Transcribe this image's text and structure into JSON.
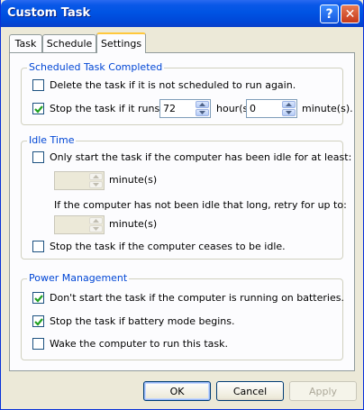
{
  "window": {
    "title": "Custom Task"
  },
  "title_buttons": {
    "help": "?",
    "close": "✕"
  },
  "tabs": [
    {
      "label": "Task"
    },
    {
      "label": "Schedule"
    },
    {
      "label": "Settings"
    }
  ],
  "scheduled": {
    "legend": "Scheduled Task Completed",
    "delete_label": "Delete the task if it is not scheduled to run again.",
    "delete_checked": false,
    "stop_label": "Stop the task if it runs for:",
    "stop_checked": true,
    "hours_value": "72",
    "hours_unit": "hour(s)",
    "minutes_value": "0",
    "minutes_unit": "minute(s)."
  },
  "idle": {
    "legend": "Idle Time",
    "only_start_label": "Only start the task if the computer has been idle for at least:",
    "only_start_checked": false,
    "idle_minutes_value": "",
    "idle_minutes_unit": "minute(s)",
    "retry_label": "If the computer has not been idle that long, retry for up to:",
    "retry_minutes_value": "",
    "retry_minutes_unit": "minute(s)",
    "stop_idle_label": "Stop the task if the computer ceases to be idle.",
    "stop_idle_checked": false
  },
  "power": {
    "legend": "Power Management",
    "batteries_label": "Don't start the task if the computer is running on batteries.",
    "batteries_checked": true,
    "battery_mode_label": "Stop the task if battery mode begins.",
    "battery_mode_checked": true,
    "wake_label": "Wake the computer to run this task.",
    "wake_checked": false
  },
  "buttons": {
    "ok": "OK",
    "cancel": "Cancel",
    "apply": "Apply"
  },
  "colors": {
    "titlebar": "#0054e3",
    "legend": "#0046d5",
    "checkmark": "#21a121"
  }
}
